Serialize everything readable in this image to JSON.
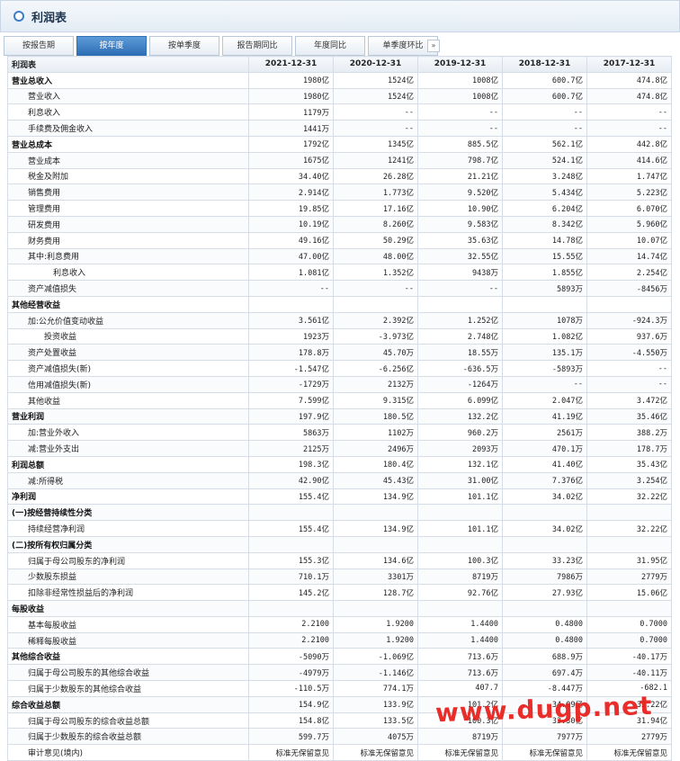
{
  "title": "利润表",
  "tabs": [
    {
      "label": "按报告期",
      "active": false
    },
    {
      "label": "按年度",
      "active": true
    },
    {
      "label": "按单季度",
      "active": false
    },
    {
      "label": "报告期同比",
      "active": false
    },
    {
      "label": "年度同比",
      "active": false
    },
    {
      "label": "单季度环比",
      "active": false
    }
  ],
  "tab_more": "»",
  "header": [
    "利润表",
    "2021-12-31",
    "2020-12-31",
    "2019-12-31",
    "2018-12-31",
    "2017-12-31"
  ],
  "rows": [
    {
      "label": "营业总收入",
      "bold": true,
      "indent": 0,
      "values": [
        "1980亿",
        "1524亿",
        "1008亿",
        "600.7亿",
        "474.8亿"
      ]
    },
    {
      "label": "营业收入",
      "bold": false,
      "indent": 1,
      "values": [
        "1980亿",
        "1524亿",
        "1008亿",
        "600.7亿",
        "474.8亿"
      ]
    },
    {
      "label": "利息收入",
      "bold": false,
      "indent": 1,
      "values": [
        "1179万",
        "--",
        "--",
        "--",
        "--"
      ]
    },
    {
      "label": "手续费及佣金收入",
      "bold": false,
      "indent": 1,
      "values": [
        "1441万",
        "--",
        "--",
        "--",
        "--"
      ]
    },
    {
      "label": "营业总成本",
      "bold": true,
      "indent": 0,
      "values": [
        "1792亿",
        "1345亿",
        "885.5亿",
        "562.1亿",
        "442.8亿"
      ]
    },
    {
      "label": "营业成本",
      "bold": false,
      "indent": 1,
      "values": [
        "1675亿",
        "1241亿",
        "798.7亿",
        "524.1亿",
        "414.6亿"
      ]
    },
    {
      "label": "税金及附加",
      "bold": false,
      "indent": 1,
      "values": [
        "34.40亿",
        "26.28亿",
        "21.21亿",
        "3.248亿",
        "1.747亿"
      ]
    },
    {
      "label": "销售费用",
      "bold": false,
      "indent": 1,
      "values": [
        "2.914亿",
        "1.773亿",
        "9.520亿",
        "5.434亿",
        "5.223亿"
      ]
    },
    {
      "label": "管理费用",
      "bold": false,
      "indent": 1,
      "values": [
        "19.85亿",
        "17.16亿",
        "10.90亿",
        "6.204亿",
        "6.070亿"
      ]
    },
    {
      "label": "研发费用",
      "bold": false,
      "indent": 1,
      "values": [
        "10.19亿",
        "8.260亿",
        "9.583亿",
        "8.342亿",
        "5.960亿"
      ]
    },
    {
      "label": "财务费用",
      "bold": false,
      "indent": 1,
      "values": [
        "49.16亿",
        "50.29亿",
        "35.63亿",
        "14.78亿",
        "10.07亿"
      ]
    },
    {
      "label": "其中:利息费用",
      "bold": false,
      "indent": 1,
      "values": [
        "47.00亿",
        "48.00亿",
        "32.55亿",
        "15.55亿",
        "14.74亿"
      ]
    },
    {
      "label": "利息收入",
      "bold": false,
      "indent": 3,
      "values": [
        "1.081亿",
        "1.352亿",
        "9438万",
        "1.855亿",
        "2.254亿"
      ]
    },
    {
      "label": "资产减值损失",
      "bold": false,
      "indent": 1,
      "values": [
        "--",
        "--",
        "--",
        "5893万",
        "-8456万"
      ]
    },
    {
      "label": "其他经营收益",
      "bold": true,
      "indent": 0,
      "values": [
        "",
        "",
        "",
        "",
        ""
      ]
    },
    {
      "label": "加:公允价值变动收益",
      "bold": false,
      "indent": 1,
      "values": [
        "3.561亿",
        "2.392亿",
        "1.252亿",
        "1078万",
        "-924.3万"
      ]
    },
    {
      "label": "投资收益",
      "bold": false,
      "indent": 2,
      "values": [
        "1923万",
        "-3.973亿",
        "2.748亿",
        "1.082亿",
        "937.6万"
      ]
    },
    {
      "label": "资产处置收益",
      "bold": false,
      "indent": 1,
      "values": [
        "178.8万",
        "45.70万",
        "18.55万",
        "135.1万",
        "-4.550万"
      ]
    },
    {
      "label": "资产减值损失(新)",
      "bold": false,
      "indent": 1,
      "values": [
        "-1.547亿",
        "-6.256亿",
        "-636.5万",
        "-5893万",
        "--"
      ]
    },
    {
      "label": "信用减值损失(新)",
      "bold": false,
      "indent": 1,
      "values": [
        "-1729万",
        "2132万",
        "-1264万",
        "--",
        "--"
      ]
    },
    {
      "label": "其他收益",
      "bold": false,
      "indent": 1,
      "values": [
        "7.599亿",
        "9.315亿",
        "6.099亿",
        "2.047亿",
        "3.472亿"
      ]
    },
    {
      "label": "营业利润",
      "bold": true,
      "indent": 0,
      "values": [
        "197.9亿",
        "180.5亿",
        "132.2亿",
        "41.19亿",
        "35.46亿"
      ]
    },
    {
      "label": "加:营业外收入",
      "bold": false,
      "indent": 1,
      "values": [
        "5863万",
        "1102万",
        "960.2万",
        "2561万",
        "388.2万"
      ]
    },
    {
      "label": "减:营业外支出",
      "bold": false,
      "indent": 1,
      "values": [
        "2125万",
        "2496万",
        "2093万",
        "470.1万",
        "178.7万"
      ]
    },
    {
      "label": "利润总额",
      "bold": true,
      "indent": 0,
      "values": [
        "198.3亿",
        "180.4亿",
        "132.1亿",
        "41.40亿",
        "35.43亿"
      ]
    },
    {
      "label": "减:所得税",
      "bold": false,
      "indent": 1,
      "values": [
        "42.90亿",
        "45.43亿",
        "31.00亿",
        "7.376亿",
        "3.254亿"
      ]
    },
    {
      "label": "净利润",
      "bold": true,
      "indent": 0,
      "values": [
        "155.4亿",
        "134.9亿",
        "101.1亿",
        "34.02亿",
        "32.22亿"
      ]
    },
    {
      "label": "(一)按经营持续性分类",
      "bold": true,
      "indent": 0,
      "values": [
        "",
        "",
        "",
        "",
        ""
      ]
    },
    {
      "label": "持续经营净利润",
      "bold": false,
      "indent": 1,
      "values": [
        "155.4亿",
        "134.9亿",
        "101.1亿",
        "34.02亿",
        "32.22亿"
      ]
    },
    {
      "label": "(二)按所有权归属分类",
      "bold": true,
      "indent": 0,
      "values": [
        "",
        "",
        "",
        "",
        ""
      ]
    },
    {
      "label": "归属于母公司股东的净利润",
      "bold": false,
      "indent": 1,
      "values": [
        "155.3亿",
        "134.6亿",
        "100.3亿",
        "33.23亿",
        "31.95亿"
      ]
    },
    {
      "label": "少数股东损益",
      "bold": false,
      "indent": 1,
      "values": [
        "710.1万",
        "3301万",
        "8719万",
        "7986万",
        "2779万"
      ]
    },
    {
      "label": "扣除非经常性损益后的净利润",
      "bold": false,
      "indent": 1,
      "values": [
        "145.2亿",
        "128.7亿",
        "92.76亿",
        "27.93亿",
        "15.06亿"
      ]
    },
    {
      "label": "每股收益",
      "bold": true,
      "indent": 0,
      "values": [
        "",
        "",
        "",
        "",
        ""
      ]
    },
    {
      "label": "基本每股收益",
      "bold": false,
      "indent": 1,
      "values": [
        "2.2100",
        "1.9200",
        "1.4400",
        "0.4800",
        "0.7000"
      ]
    },
    {
      "label": "稀释每股收益",
      "bold": false,
      "indent": 1,
      "values": [
        "2.2100",
        "1.9200",
        "1.4400",
        "0.4800",
        "0.7000"
      ]
    },
    {
      "label": "其他综合收益",
      "bold": true,
      "indent": 0,
      "values": [
        "-5090万",
        "-1.069亿",
        "713.6万",
        "688.9万",
        "-40.17万"
      ]
    },
    {
      "label": "归属于母公司股东的其他综合收益",
      "bold": false,
      "indent": 1,
      "values": [
        "-4979万",
        "-1.146亿",
        "713.6万",
        "697.4万",
        "-40.11万"
      ]
    },
    {
      "label": "归属于少数股东的其他综合收益",
      "bold": false,
      "indent": 1,
      "values": [
        "-110.5万",
        "774.1万",
        "407.7",
        "-8.447万",
        "-682.1"
      ]
    },
    {
      "label": "综合收益总额",
      "bold": true,
      "indent": 0,
      "values": [
        "154.9亿",
        "133.9亿",
        "101.2亿",
        "34.09亿",
        "32.22亿"
      ]
    },
    {
      "label": "归属于母公司股东的综合收益总额",
      "bold": false,
      "indent": 1,
      "values": [
        "154.8亿",
        "133.5亿",
        "100.3亿",
        "33.30亿",
        "31.94亿"
      ]
    },
    {
      "label": "归属于少数股东的综合收益总额",
      "bold": false,
      "indent": 1,
      "values": [
        "599.7万",
        "4075万",
        "8719万",
        "7977万",
        "2779万"
      ]
    },
    {
      "label": "审计意见(境内)",
      "bold": false,
      "indent": 1,
      "values": [
        "标准无保留意见",
        "标准无保留意见",
        "标准无保留意见",
        "标准无保留意见",
        "标准无保留意见"
      ]
    }
  ],
  "watermark": "www.dugp.net"
}
